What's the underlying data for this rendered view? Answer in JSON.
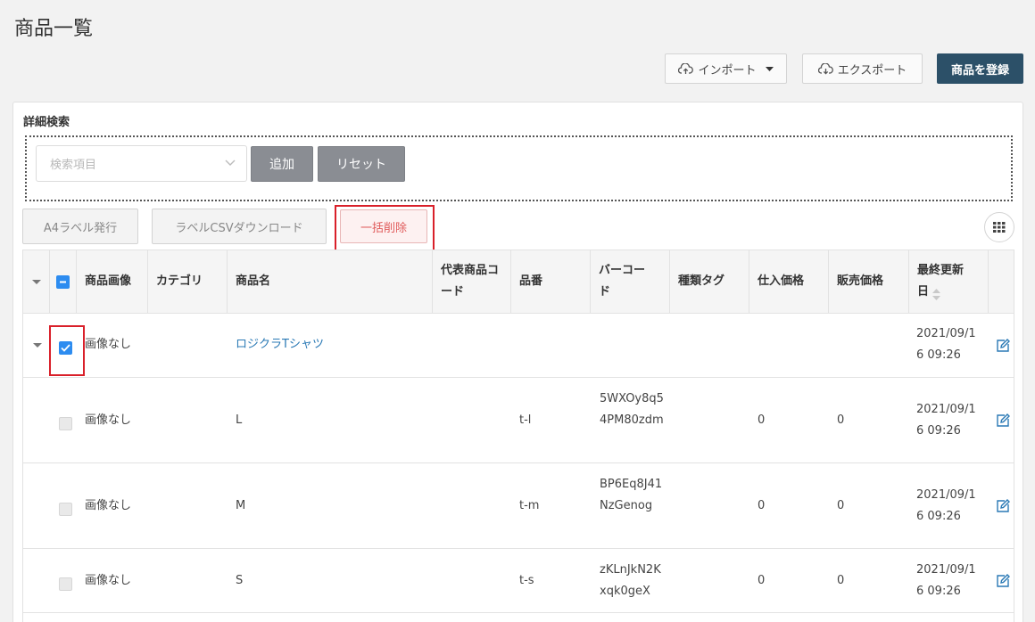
{
  "page": {
    "title": "商品一覧"
  },
  "toolbar": {
    "import_label": "インポート",
    "export_label": "エクスポート",
    "register_label": "商品を登録"
  },
  "search": {
    "title": "詳細検索",
    "select_placeholder": "検索項目",
    "add_label": "追加",
    "reset_label": "リセット"
  },
  "actions": {
    "a4_label": "A4ラベル発行",
    "csv_label": "ラベルCSVダウンロード",
    "bulk_delete_label": "一括削除"
  },
  "table": {
    "headers": {
      "image": "商品画像",
      "category": "カテゴリ",
      "name": "商品名",
      "rep_code": "代表商品コード",
      "sku": "品番",
      "barcode": "バーコード",
      "tags": "種類タグ",
      "cost": "仕入価格",
      "price": "販売価格",
      "updated": "最終更新日"
    },
    "rows": [
      {
        "image": "画像なし",
        "name": "ロジクラTシャツ",
        "updated": "2021/09/16 09:26"
      },
      {
        "image": "画像なし",
        "name": "L",
        "sku": "t-l",
        "barcode": "5WXOy8q54PM80zdm",
        "cost": "0",
        "price": "0",
        "updated": "2021/09/16 09:26"
      },
      {
        "image": "画像なし",
        "name": "M",
        "sku": "t-m",
        "barcode": "BP6Eq8J41NzGenog",
        "cost": "0",
        "price": "0",
        "updated": "2021/09/16 09:26"
      },
      {
        "image": "画像なし",
        "name": "S",
        "sku": "t-s",
        "barcode": "zKLnJkN2Kxqk0geX",
        "cost": "0",
        "price": "0",
        "updated": "2021/09/16 09:26"
      }
    ]
  },
  "colors": {
    "primary": "#2c5068",
    "link": "#2a79b5",
    "checkbox": "#2d8cf0",
    "danger": "#e05b5b",
    "highlight": "#d9202a"
  },
  "icons": [
    "cloud-upload-icon",
    "caret-down-icon",
    "cloud-download-icon",
    "chevron-down-icon",
    "grid-icon",
    "edit-icon",
    "sort-icon"
  ]
}
